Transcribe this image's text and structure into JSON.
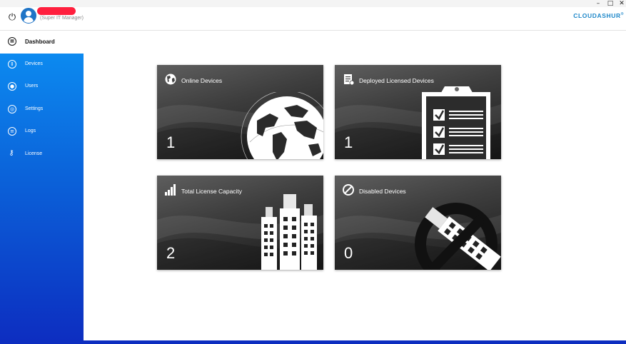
{
  "window": {
    "minimize": "–",
    "maximize": "□",
    "close": "✕"
  },
  "header": {
    "role": "(Super IT Manager)",
    "brand": "CLOUDASHUR",
    "brand_mark": "®",
    "power_icon": "power-icon",
    "avatar_icon": "user-avatar-icon"
  },
  "sidebar": {
    "dashboard": {
      "label": "Dashboard",
      "icon": "dashboard-icon"
    },
    "items": [
      {
        "label": "Devices",
        "icon": "devices-icon"
      },
      {
        "label": "Users",
        "icon": "users-icon"
      },
      {
        "label": "Settings",
        "icon": "settings-icon"
      },
      {
        "label": "Logs",
        "icon": "logs-icon"
      },
      {
        "label": "License",
        "icon": "license-icon"
      }
    ]
  },
  "cards": [
    {
      "title": "Online Devices",
      "count": "1",
      "icon": "globe-icon"
    },
    {
      "title": "Deployed Licensed Devices",
      "count": "1",
      "icon": "clipboard-check-icon"
    },
    {
      "title": "Total License Capacity",
      "count": "2",
      "icon": "signal-bars-icon"
    },
    {
      "title": "Disabled Devices",
      "count": "0",
      "icon": "prohibited-icon"
    }
  ],
  "colors": {
    "sidebar_top": "#0c8af0",
    "sidebar_bottom": "#0d2dc0",
    "brand": "#1d87c9",
    "card_bg": "#3e3e3e"
  }
}
